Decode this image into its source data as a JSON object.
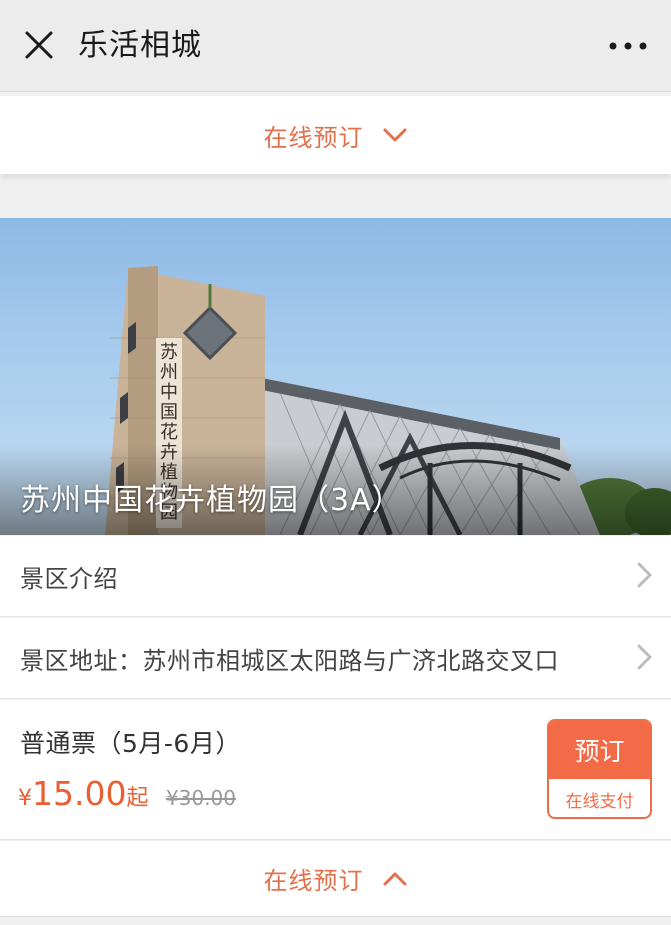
{
  "header": {
    "title": "乐活相城",
    "close_icon": "close-icon",
    "more_icon": "more-icon"
  },
  "booking_toggle_top": {
    "label": "在线预订",
    "icon": "chevron-down-icon"
  },
  "attraction": {
    "title": "苏州中国花卉植物园（3A）",
    "photo_sign": [
      "苏",
      "州",
      "中",
      "国",
      "花",
      "卉",
      "植",
      "物",
      "园"
    ]
  },
  "list": [
    {
      "label": "景区介绍"
    },
    {
      "label": "景区地址：苏州市相城区太阳路与广济北路交叉口"
    }
  ],
  "ticket": {
    "name": "普通票（5月-6月）",
    "currency": "¥",
    "price": "15.00",
    "price_suffix": "起",
    "original_price": "¥30.00",
    "button_label": "预订",
    "button_sub": "在线支付"
  },
  "booking_toggle_bottom": {
    "label": "在线预订",
    "icon": "chevron-up-icon"
  },
  "colors": {
    "accent": "#e2704a",
    "button": "#f26b46",
    "header_bg": "#ececec"
  }
}
